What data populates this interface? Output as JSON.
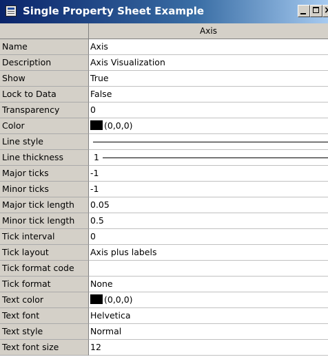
{
  "window": {
    "title": "Single Property Sheet Example",
    "close_glyph": "×"
  },
  "column_header": "Axis",
  "rows": [
    {
      "label": "Name",
      "value": "Axis"
    },
    {
      "label": "Description",
      "value": "Axis Visualization"
    },
    {
      "label": "Show",
      "value": "True"
    },
    {
      "label": "Lock to Data",
      "value": "False"
    },
    {
      "label": "Transparency",
      "value": "0"
    },
    {
      "label": "Color",
      "value": "(0,0,0)",
      "swatch": "#000000"
    },
    {
      "label": "Line style",
      "value": ""
    },
    {
      "label": "Line thickness",
      "value": "1"
    },
    {
      "label": "Major ticks",
      "value": "-1"
    },
    {
      "label": "Minor ticks",
      "value": "-1"
    },
    {
      "label": "Major tick length",
      "value": "0.05"
    },
    {
      "label": "Minor tick length",
      "value": "0.5"
    },
    {
      "label": "Tick interval",
      "value": "0"
    },
    {
      "label": "Tick layout",
      "value": "Axis plus labels"
    },
    {
      "label": "Tick format code",
      "value": ""
    },
    {
      "label": "Tick format",
      "value": "None"
    },
    {
      "label": "Text color",
      "value": "(0,0,0)",
      "swatch": "#000000"
    },
    {
      "label": "Text font",
      "value": "Helvetica"
    },
    {
      "label": "Text style",
      "value": "Normal"
    },
    {
      "label": "Text font size",
      "value": "12"
    }
  ]
}
